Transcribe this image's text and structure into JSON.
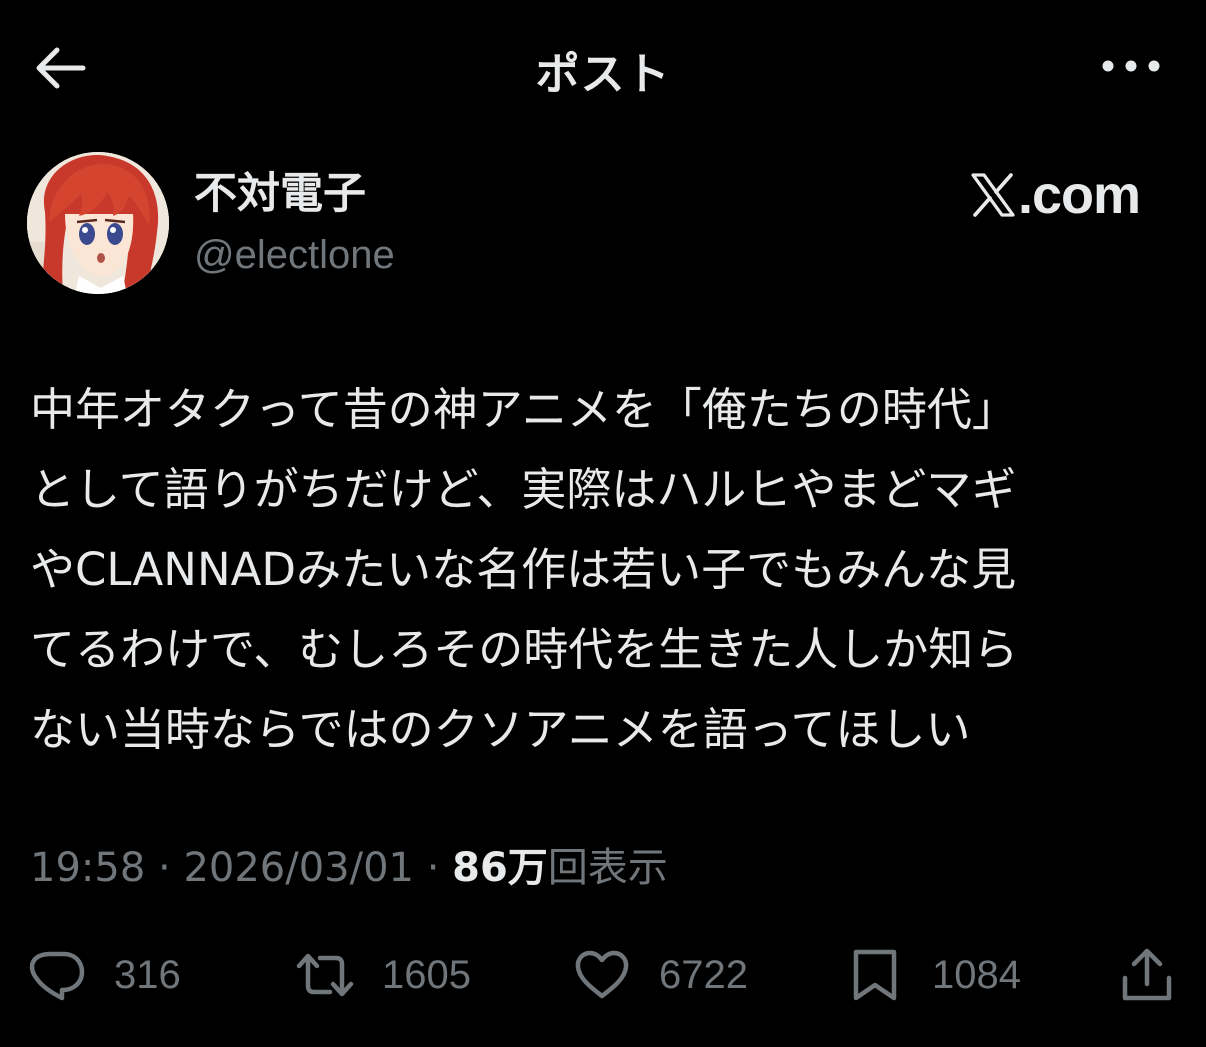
{
  "header": {
    "title": "ポスト"
  },
  "author": {
    "display_name": "不対電子",
    "handle": "@electlone"
  },
  "watermark": {
    "text": ".com"
  },
  "tweet": {
    "lines": [
      "中年オタクって昔の神アニメを「俺たちの時代」",
      "として語りがちだけど、実際はハルヒやまどマギ",
      "やCLANNADみたいな名作は若い子でもみんな見",
      "てるわけで、むしろその時代を生きた人しか知ら",
      "ない当時ならではのクソアニメを語ってほしい"
    ]
  },
  "meta": {
    "time": "19:58",
    "separator1": " · ",
    "date": "2026/03/01",
    "separator2": " · ",
    "views_count": "86万",
    "views_label": "回表示"
  },
  "actions": {
    "reply_count": "316",
    "repost_count": "1605",
    "like_count": "6722",
    "bookmark_count": "1084"
  },
  "icons": {
    "back": "arrow-left-icon",
    "more": "more-horizontal-icon",
    "reply": "reply-icon",
    "repost": "repost-icon",
    "like": "heart-icon",
    "bookmark": "bookmark-icon",
    "share": "share-icon"
  },
  "colors": {
    "background": "#000000",
    "text_primary": "#e7e9ea",
    "text_secondary": "#71767b"
  }
}
